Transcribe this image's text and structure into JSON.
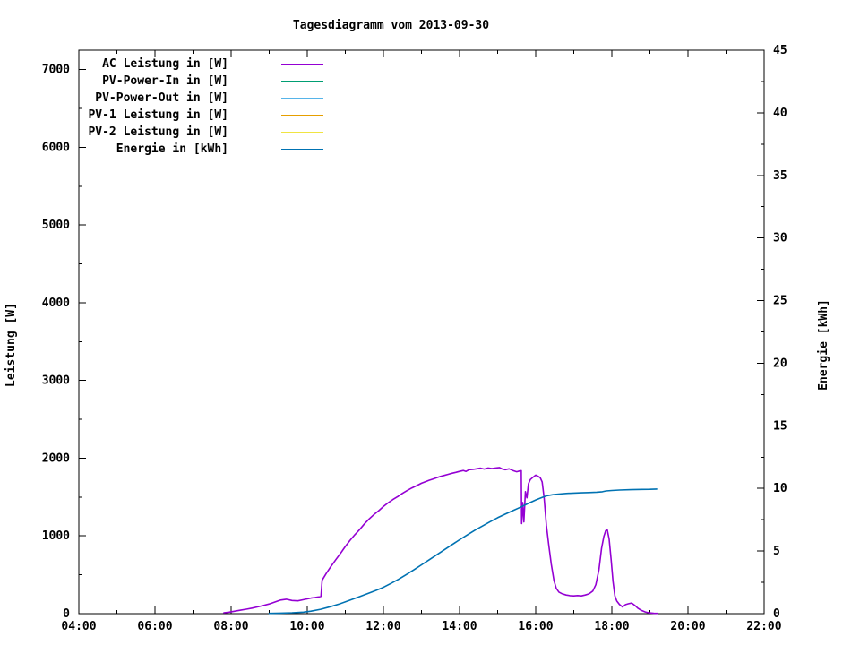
{
  "title": "Tagesdiagramm vom 2013-09-30",
  "axes": {
    "left_label": "Leistung [W]",
    "right_label": "Energie [kWh]"
  },
  "chart_data": {
    "type": "line",
    "title": "Tagesdiagramm vom 2013-09-30",
    "grid": false,
    "legend_position": "top-left-inside",
    "x_axis": {
      "unit": "time-of-day",
      "range_hours": [
        4,
        22
      ],
      "major_step_hours": 2,
      "minor_step_hours": 1,
      "tick_labels": [
        "04:00",
        "06:00",
        "08:00",
        "10:00",
        "12:00",
        "14:00",
        "16:00",
        "18:00",
        "20:00",
        "22:00"
      ]
    },
    "y_left": {
      "label": "Leistung [W]",
      "range": [
        0,
        7250
      ],
      "major_ticks": [
        0,
        1000,
        2000,
        3000,
        4000,
        5000,
        6000,
        7000
      ],
      "minor_step": 500
    },
    "y_right": {
      "label": "Energie [kWh]",
      "range": [
        0,
        45
      ],
      "major_ticks": [
        0,
        5,
        10,
        15,
        20,
        25,
        30,
        35,
        40,
        45
      ],
      "minor_step": 2.5
    },
    "series": [
      {
        "name": "AC Leistung in [W]",
        "slug": "ac-leistung",
        "color": "#9400d3",
        "axis": "left",
        "points": [
          [
            7.81,
            12
          ],
          [
            7.95,
            20
          ],
          [
            8.1,
            32
          ],
          [
            8.25,
            45
          ],
          [
            8.4,
            58
          ],
          [
            8.55,
            72
          ],
          [
            8.7,
            88
          ],
          [
            8.85,
            105
          ],
          [
            9.0,
            125
          ],
          [
            9.15,
            150
          ],
          [
            9.3,
            175
          ],
          [
            9.45,
            185
          ],
          [
            9.6,
            170
          ],
          [
            9.75,
            165
          ],
          [
            9.9,
            180
          ],
          [
            10.0,
            190
          ],
          [
            10.1,
            200
          ],
          [
            10.2,
            208
          ],
          [
            10.3,
            215
          ],
          [
            10.36,
            222
          ],
          [
            10.39,
            430
          ],
          [
            10.5,
            520
          ],
          [
            10.62,
            605
          ],
          [
            10.75,
            695
          ],
          [
            10.88,
            780
          ],
          [
            11.0,
            865
          ],
          [
            11.12,
            940
          ],
          [
            11.25,
            1015
          ],
          [
            11.38,
            1085
          ],
          [
            11.5,
            1155
          ],
          [
            11.62,
            1215
          ],
          [
            11.75,
            1275
          ],
          [
            11.88,
            1325
          ],
          [
            12.0,
            1378
          ],
          [
            12.12,
            1425
          ],
          [
            12.25,
            1468
          ],
          [
            12.38,
            1508
          ],
          [
            12.5,
            1548
          ],
          [
            12.62,
            1582
          ],
          [
            12.75,
            1618
          ],
          [
            12.88,
            1648
          ],
          [
            13.0,
            1678
          ],
          [
            13.1,
            1698
          ],
          [
            13.2,
            1716
          ],
          [
            13.3,
            1732
          ],
          [
            13.4,
            1748
          ],
          [
            13.5,
            1766
          ],
          [
            13.6,
            1778
          ],
          [
            13.7,
            1792
          ],
          [
            13.8,
            1806
          ],
          [
            13.9,
            1818
          ],
          [
            14.0,
            1830
          ],
          [
            14.1,
            1842
          ],
          [
            14.17,
            1830
          ],
          [
            14.25,
            1852
          ],
          [
            14.35,
            1856
          ],
          [
            14.45,
            1864
          ],
          [
            14.55,
            1872
          ],
          [
            14.65,
            1860
          ],
          [
            14.75,
            1874
          ],
          [
            14.85,
            1866
          ],
          [
            14.95,
            1874
          ],
          [
            15.05,
            1880
          ],
          [
            15.12,
            1862
          ],
          [
            15.2,
            1852
          ],
          [
            15.3,
            1864
          ],
          [
            15.4,
            1842
          ],
          [
            15.5,
            1826
          ],
          [
            15.58,
            1836
          ],
          [
            15.62,
            1840
          ],
          [
            15.63,
            1160
          ],
          [
            15.66,
            1430
          ],
          [
            15.69,
            1180
          ],
          [
            15.73,
            1570
          ],
          [
            15.77,
            1490
          ],
          [
            15.81,
            1670
          ],
          [
            15.86,
            1725
          ],
          [
            15.93,
            1755
          ],
          [
            16.0,
            1782
          ],
          [
            16.06,
            1768
          ],
          [
            16.12,
            1748
          ],
          [
            16.17,
            1695
          ],
          [
            16.22,
            1490
          ],
          [
            16.28,
            1140
          ],
          [
            16.34,
            890
          ],
          [
            16.41,
            635
          ],
          [
            16.48,
            425
          ],
          [
            16.54,
            325
          ],
          [
            16.61,
            278
          ],
          [
            16.7,
            255
          ],
          [
            16.8,
            240
          ],
          [
            16.9,
            232
          ],
          [
            17.0,
            228
          ],
          [
            17.1,
            233
          ],
          [
            17.2,
            228
          ],
          [
            17.3,
            240
          ],
          [
            17.4,
            255
          ],
          [
            17.5,
            292
          ],
          [
            17.58,
            372
          ],
          [
            17.66,
            565
          ],
          [
            17.73,
            840
          ],
          [
            17.79,
            995
          ],
          [
            17.84,
            1068
          ],
          [
            17.88,
            1078
          ],
          [
            17.93,
            958
          ],
          [
            17.98,
            695
          ],
          [
            18.03,
            415
          ],
          [
            18.08,
            228
          ],
          [
            18.13,
            162
          ],
          [
            18.2,
            118
          ],
          [
            18.28,
            86
          ],
          [
            18.36,
            116
          ],
          [
            18.44,
            128
          ],
          [
            18.52,
            136
          ],
          [
            18.6,
            108
          ],
          [
            18.68,
            72
          ],
          [
            18.78,
            42
          ],
          [
            18.88,
            22
          ],
          [
            18.98,
            10
          ],
          [
            19.1,
            5
          ],
          [
            19.2,
            3
          ]
        ]
      },
      {
        "name": "PV-Power-In in [W]",
        "slug": "pv-power-in",
        "color": "#009e73",
        "axis": "left",
        "points": []
      },
      {
        "name": "PV-Power-Out in [W]",
        "slug": "pv-power-out",
        "color": "#56b4e9",
        "axis": "left",
        "points": []
      },
      {
        "name": "PV-1 Leistung in [W]",
        "slug": "pv1-leistung",
        "color": "#e69f00",
        "axis": "left",
        "points": []
      },
      {
        "name": "PV-2 Leistung in [W]",
        "slug": "pv2-leistung",
        "color": "#f0e442",
        "axis": "left",
        "points": []
      },
      {
        "name": "Energie in [kWh]",
        "slug": "energie",
        "color": "#0072b2",
        "axis": "right",
        "points": [
          [
            9.0,
            0.02
          ],
          [
            9.3,
            0.04
          ],
          [
            9.6,
            0.07
          ],
          [
            9.9,
            0.12
          ],
          [
            10.1,
            0.2
          ],
          [
            10.35,
            0.35
          ],
          [
            10.6,
            0.55
          ],
          [
            10.85,
            0.78
          ],
          [
            11.1,
            1.05
          ],
          [
            11.35,
            1.33
          ],
          [
            11.6,
            1.62
          ],
          [
            11.8,
            1.85
          ],
          [
            12.0,
            2.1
          ],
          [
            12.2,
            2.42
          ],
          [
            12.4,
            2.75
          ],
          [
            12.6,
            3.12
          ],
          [
            12.8,
            3.5
          ],
          [
            13.0,
            3.9
          ],
          [
            13.2,
            4.3
          ],
          [
            13.4,
            4.7
          ],
          [
            13.6,
            5.1
          ],
          [
            13.8,
            5.5
          ],
          [
            14.0,
            5.9
          ],
          [
            14.2,
            6.28
          ],
          [
            14.4,
            6.66
          ],
          [
            14.6,
            7.0
          ],
          [
            14.8,
            7.34
          ],
          [
            15.0,
            7.66
          ],
          [
            15.2,
            7.95
          ],
          [
            15.4,
            8.23
          ],
          [
            15.6,
            8.5
          ],
          [
            15.8,
            8.8
          ],
          [
            16.0,
            9.08
          ],
          [
            16.1,
            9.2
          ],
          [
            16.2,
            9.32
          ],
          [
            16.3,
            9.42
          ],
          [
            16.45,
            9.5
          ],
          [
            16.6,
            9.55
          ],
          [
            16.8,
            9.6
          ],
          [
            17.0,
            9.63
          ],
          [
            17.2,
            9.65
          ],
          [
            17.4,
            9.67
          ],
          [
            17.6,
            9.7
          ],
          [
            17.75,
            9.74
          ],
          [
            17.85,
            9.8
          ],
          [
            18.0,
            9.84
          ],
          [
            18.2,
            9.87
          ],
          [
            18.5,
            9.9
          ],
          [
            18.8,
            9.92
          ],
          [
            19.0,
            9.93
          ],
          [
            19.18,
            9.95
          ]
        ]
      }
    ]
  }
}
